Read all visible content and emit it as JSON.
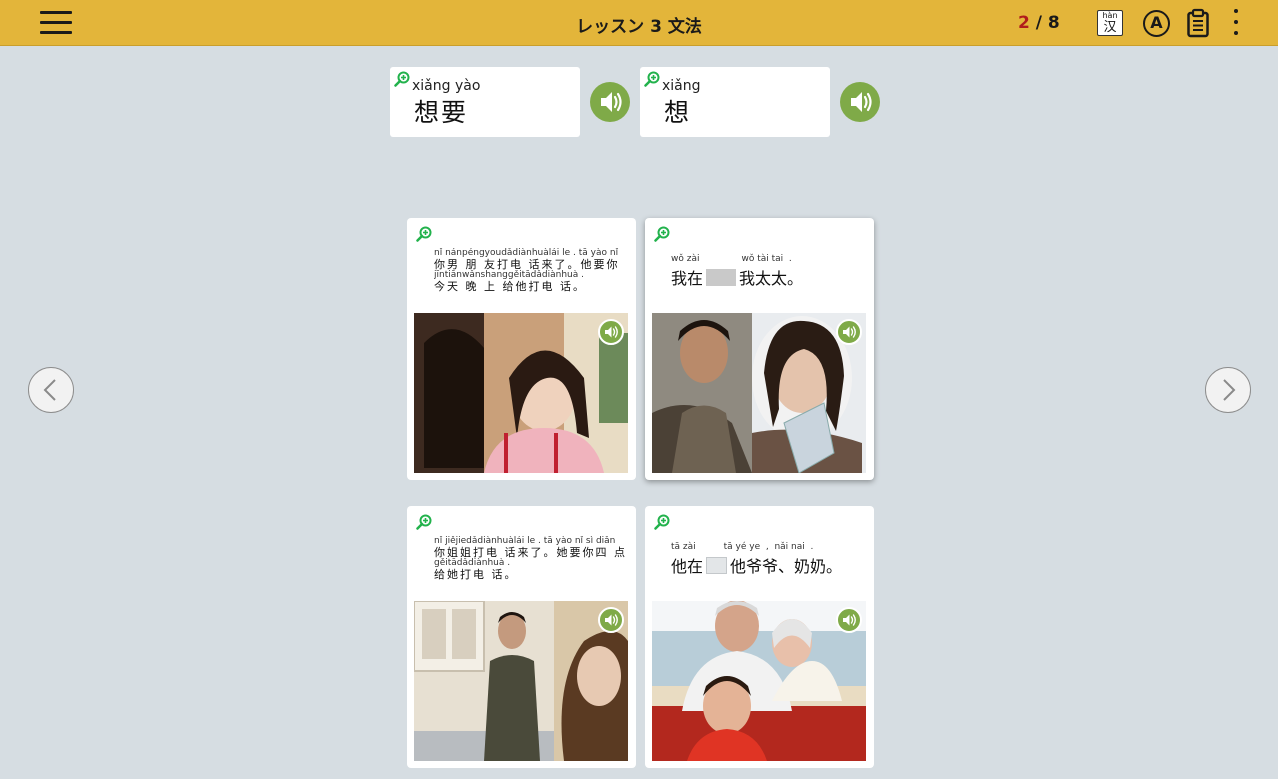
{
  "header": {
    "title": "レッスン 3 文法",
    "progress_current": "2",
    "progress_sep": " / ",
    "progress_total": "8",
    "han_pinyin": "hàn",
    "han_char": "汉",
    "a_label": "A"
  },
  "vocab": [
    {
      "pinyin": "xiǎng yào",
      "hanzi": "想要"
    },
    {
      "pinyin": "xiǎng",
      "hanzi": "想"
    }
  ],
  "cards": [
    {
      "lines": [
        {
          "py": "nǐ nánpéngyoudǎdiànhuàlái le . tā yào nǐ",
          "hz": "你男 朋 友打电 话来了。他要你"
        },
        {
          "py": "jīntiānwǎnshanggěitādǎdiànhuà .",
          "hz": "今天 晚  上 给他打电 话。"
        }
      ]
    },
    {
      "py1": "wǒ zài",
      "py2": "wǒ tài tai  .",
      "hz1": "我在",
      "hz2": "我太太。"
    },
    {
      "lines": [
        {
          "py": "nǐ jiějiedǎdiànhuàlái le . tā yào nǐ sì diǎn",
          "hz": "你姐姐打电 话来了。她要你四 点"
        },
        {
          "py": "gěitādǎdiànhuà .",
          "hz": "给她打电 话。"
        }
      ]
    },
    {
      "py1": "tā zài",
      "py2": "tā yé ye  ,  nǎi nai  .",
      "hz1": "他在",
      "hz2": "他爷爷、奶奶。"
    }
  ],
  "colors": {
    "header": "#e3b53a",
    "speaker": "#7faa48",
    "zoom": "#22b24c",
    "progress_current": "#b01c1c"
  }
}
